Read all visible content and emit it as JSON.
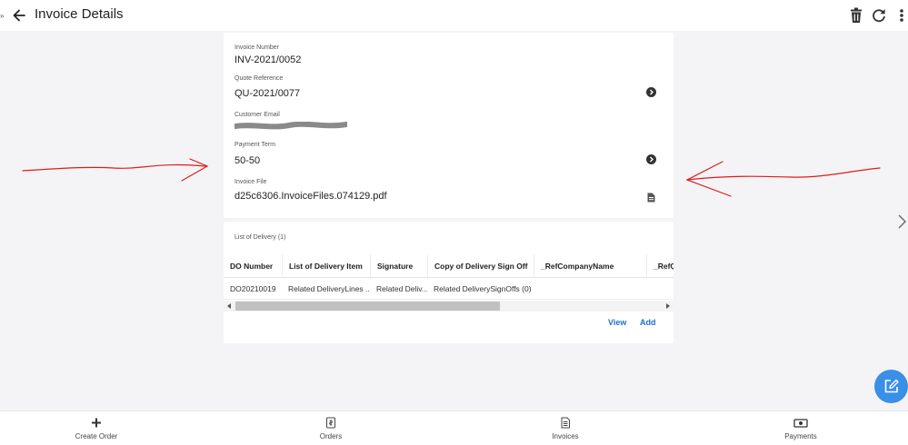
{
  "header": {
    "edge_glyph": "»",
    "title": "Invoice Details",
    "icons": [
      "arrow-left-icon",
      "trash-icon",
      "refresh-icon",
      "more-vert-icon"
    ]
  },
  "invoice": {
    "fields": [
      {
        "label": "Invoice Number",
        "value": "INV-2021/0052"
      },
      {
        "label": "Quote Reference",
        "value": "QU-2021/0077"
      },
      {
        "label": "Customer Email",
        "value": ""
      },
      {
        "label": "Payment Term",
        "value": "50-50"
      },
      {
        "label": "Invoice File",
        "value": "d25c6306.InvoiceFiles.074129.pdf"
      }
    ]
  },
  "delivery": {
    "list_label": "List of Delivery (1)",
    "columns": [
      "DO Number",
      "List of Delivery Item",
      "Signature",
      "Copy of Delivery Sign Off",
      "_RefCompanyName",
      "_RefQ"
    ],
    "rows": [
      [
        "DO20210019",
        "Related DeliveryLines ...",
        "Related Deliv...",
        "Related DeliverySignOffs (0)",
        "",
        ""
      ]
    ],
    "view_label": "View",
    "add_label": "Add"
  },
  "bottom_nav": [
    {
      "label": "Create Order",
      "icon": "plus-icon"
    },
    {
      "label": "Orders",
      "icon": "orders-icon"
    },
    {
      "label": "Invoices",
      "icon": "invoice-icon"
    },
    {
      "label": "Payments",
      "icon": "payments-icon"
    }
  ],
  "colors": {
    "accent": "#1e6fcc",
    "fab": "#3a8fe6",
    "annotation": "#e01b1b",
    "background": "#f4f4f6"
  }
}
